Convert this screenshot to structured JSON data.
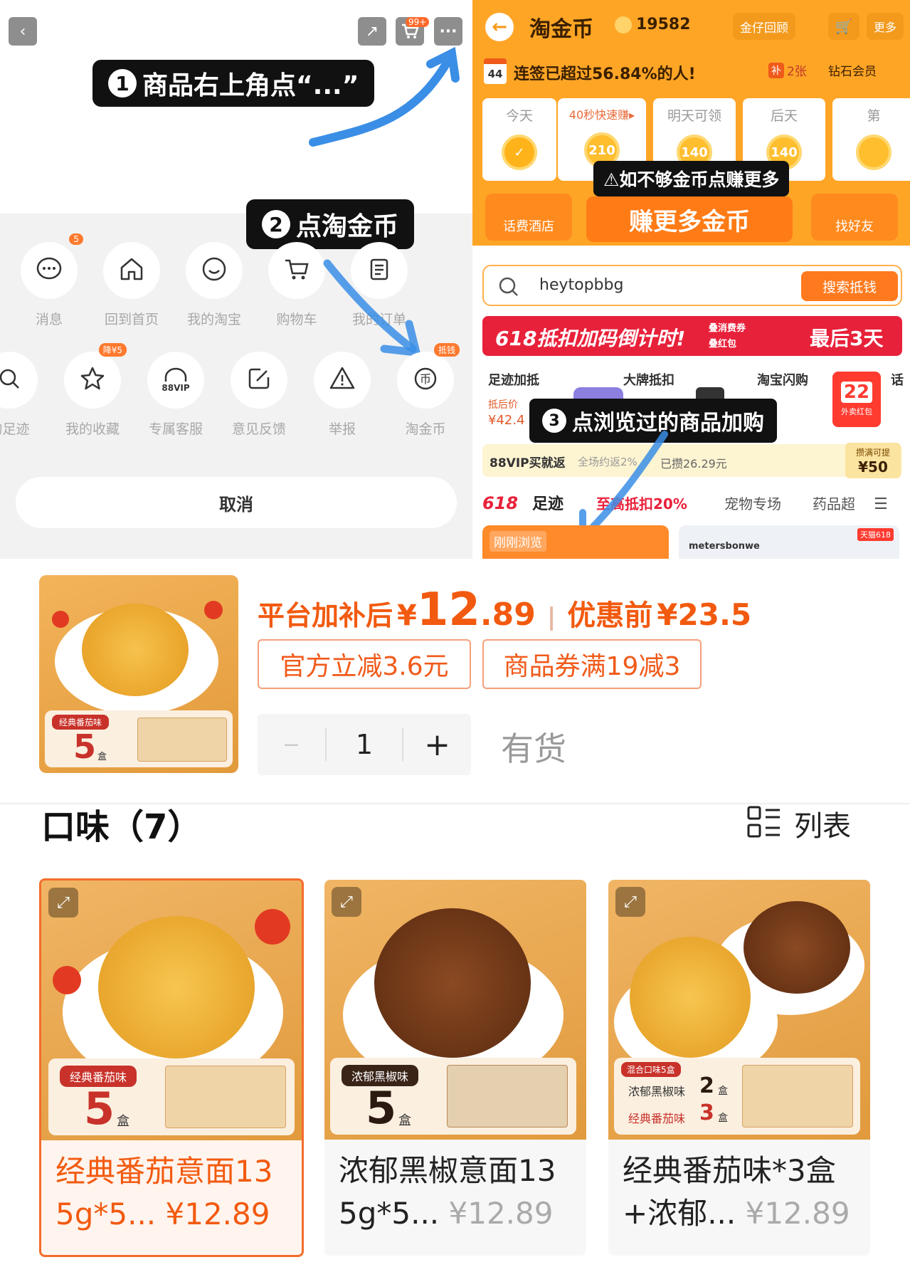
{
  "left": {
    "step1": "商品右上角点“...”",
    "step2": "点淘金币",
    "step1_num": "1",
    "step2_num": "2",
    "cart_badge": "99+",
    "menu_row1": [
      {
        "label": "消息",
        "icon": "message-icon",
        "badge": "5"
      },
      {
        "label": "回到首页",
        "icon": "home-icon",
        "badge": ""
      },
      {
        "label": "我的淘宝",
        "icon": "smile-icon",
        "badge": ""
      },
      {
        "label": "购物车",
        "icon": "cart-icon",
        "badge": ""
      },
      {
        "label": "我的订单",
        "icon": "order-icon",
        "badge": ""
      }
    ],
    "menu_row2": [
      {
        "label": "的足迹",
        "icon": "footprint-icon",
        "badge": ""
      },
      {
        "label": "我的收藏",
        "icon": "star-icon",
        "badge": "降¥5"
      },
      {
        "label": "专属客服",
        "icon": "88vip-service-icon",
        "badge": ""
      },
      {
        "label": "意见反馈",
        "icon": "edit-icon",
        "badge": ""
      },
      {
        "label": "举报",
        "icon": "warning-icon",
        "badge": ""
      },
      {
        "label": "淘金币",
        "icon": "coin-icon",
        "badge": "抵钱"
      }
    ],
    "vip_text": "88VIP",
    "cancel": "取消"
  },
  "right": {
    "title": "淘金币",
    "coins": "19582",
    "btn_gold": "金仔回顾",
    "btn_more": "更多",
    "streak_day": "44",
    "streak_text": "连签已超过56.84%的人!",
    "ticket": "2张",
    "ticket_prefix": "补",
    "diamond": "钻石会员",
    "days": [
      {
        "title": "今天",
        "coin": "✓"
      },
      {
        "title": "40秒快速赚▸",
        "coin": "210"
      },
      {
        "title": "明天可领",
        "coin": "140"
      },
      {
        "title": "后天",
        "coin": "140"
      },
      {
        "title": "第",
        "coin": ""
      }
    ],
    "tip": "⚠如不够金币点赚更多",
    "tool_left": "话费酒店",
    "earn_more": "赚更多金币",
    "tool_right": "找好友",
    "search_value": "heytopbbg",
    "search_btn": "搜索抵钱",
    "banner_left": "618抵扣加码倒计时!",
    "banner_mid1": "叠消费券",
    "banner_mid2": "叠红包",
    "banner_right": "最后3天",
    "cats": [
      "足迹加抵",
      "大牌抵扣",
      "淘宝闪购",
      "话"
    ],
    "cat_price_label": "抵后价",
    "cat_price": "¥42.4",
    "cat_coupon": "22",
    "cat_coupon_sub": "外卖红包",
    "step3": "点浏览过的商品加购",
    "step3_num": "3",
    "vip_left": "88VIP买就返",
    "vip_mid": "全场约返2%",
    "vip_saved": "已攒26.29元",
    "vip_right_top": "攒满可提",
    "vip_right": "¥50",
    "tabs": [
      "618",
      "足迹",
      "至高抵扣20%",
      "宠物专场",
      "药品超"
    ],
    "recent": "刚刚浏览",
    "brand": "metersbonwe",
    "tmall": "天猫618"
  },
  "product": {
    "price_label": "平台加补后",
    "price_yen": "¥",
    "price_int": "12",
    "price_dec": ".89",
    "sep": "|",
    "orig_label": "优惠前",
    "orig_price": "¥23.5",
    "tag1": "官方立减3.6元",
    "tag2": "商品券满19减3",
    "qty_minus": "−",
    "qty": "1",
    "qty_plus": "+",
    "stock": "有货",
    "thumb_flavor": "经典番茄味",
    "thumb_count": "5",
    "thumb_unit": "盒"
  },
  "flavors": {
    "title": "口味（7）",
    "list_label": "列表",
    "cards": [
      {
        "line1": "经典番茄意面13",
        "line2": "5g*5...",
        "price": "¥12.89",
        "flavor": "经典番茄味",
        "count": "5",
        "unit": "盒",
        "selected": true
      },
      {
        "line1": "浓郁黑椒意面13",
        "line2": "5g*5...",
        "price": "¥12.89",
        "flavor": "浓郁黑椒味",
        "count": "5",
        "unit": "盒",
        "selected": false
      },
      {
        "line1": "经典番茄味*3盒",
        "line2": "+浓郁...",
        "price": "¥12.89",
        "flavor": "混合口味5盒",
        "mix1": "浓郁黑椒味",
        "mix1n": "2",
        "mix2": "经典番茄味",
        "mix2n": "3",
        "unit": "盒",
        "selected": false
      }
    ]
  },
  "colors": {
    "accent": "#f25a0f",
    "gold": "#ffa526",
    "banner": "#e8213a"
  }
}
